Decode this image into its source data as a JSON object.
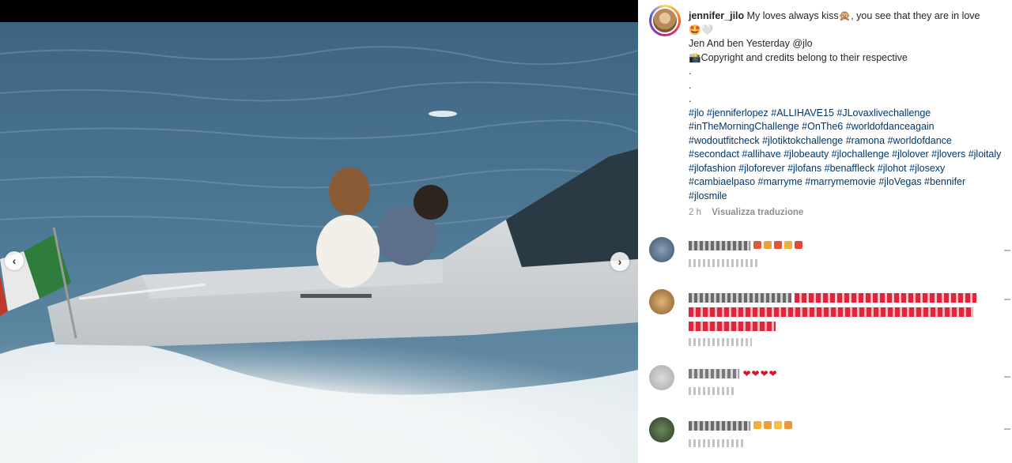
{
  "post": {
    "username": "jennifer_jilo",
    "caption_line1": "My loves always kiss🙊, you see that they are in love",
    "caption_line1b": "🤩🤍",
    "caption_line2": "Jen And ben Yesterday @jlo",
    "caption_line3": "📸Copyright and credits belong to their respective",
    "dots": [
      ".",
      ".",
      "."
    ],
    "hashtags": "#jlo #jenniferlopez #ALLIHAVE15 #JLovaxlivechallenge #inTheMorningChallenge #OnThe6 #worldofdanceagain #wodoutfitcheck #jlotiktokchallenge #ramona #worldofdance #secondact #allihave #jlobeauty #jlochallenge #jlolover #jlovers #jloitaly #jlofashion #jloforever #jlofans #benaffleck #jlohot #jlosexy #cambiaelpaso #marryme #marrymemovie #jloVegas #bennifer #jlosmile",
    "time_ago": "2 h",
    "translate_label": "Visualizza traduzione"
  },
  "media": {
    "prev_icon": "chevron-left-icon",
    "next_icon": "chevron-right-icon",
    "prev_label": "‹",
    "next_label": "›"
  },
  "comments": {
    "c1_hearts": "",
    "c3_hearts": "❤❤❤❤"
  }
}
